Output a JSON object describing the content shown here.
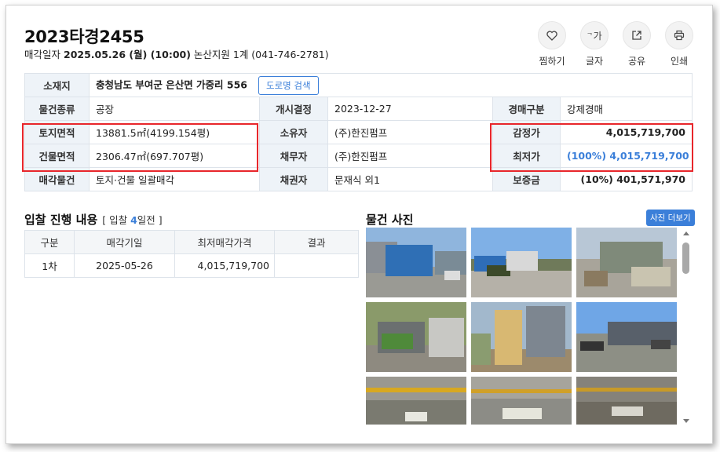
{
  "header": {
    "case_no": "2023타경2455",
    "sale_date_label": "매각일자",
    "sale_date": "2025.05.26 (월) (10:00)",
    "court": "논산지원 1계 (041-746-2781)"
  },
  "actions": [
    {
      "label": "찜하기",
      "icon": "heart-icon"
    },
    {
      "label": "글자",
      "icon": "font-size-icon",
      "glyph": "가"
    },
    {
      "label": "공유",
      "icon": "share-icon"
    },
    {
      "label": "인쇄",
      "icon": "print-icon"
    }
  ],
  "info": {
    "location_label": "소재지",
    "location": "충청남도 부여군 은산면 가중리 556",
    "road_search": "도로명 검색",
    "rows": [
      {
        "l1": "물건종류",
        "v1": "공장",
        "l2": "개시결정",
        "v2": "2023-12-27",
        "l3": "경매구분",
        "v3": "강제경매"
      },
      {
        "l1": "토지면적",
        "v1": "13881.5㎡(4199.154평)",
        "l2": "소유자",
        "v2": "(주)한진펌프",
        "l3": "감정가",
        "v3": "4,015,719,700"
      },
      {
        "l1": "건물면적",
        "v1": "2306.47㎡(697.707평)",
        "l2": "채무자",
        "v2": "(주)한진펌프",
        "l3": "최저가",
        "v3": "(100%) 4,015,719,700"
      },
      {
        "l1": "매각물건",
        "v1": "토지·건물 일괄매각",
        "l2": "채권자",
        "v2": "문재식 외1",
        "l3": "보증금",
        "v3": "(10%) 401,571,970"
      }
    ]
  },
  "bid": {
    "title": "입찰 진행 내용",
    "sub_prefix": "[ 입찰 ",
    "days": "4",
    "sub_suffix": "일전 ]",
    "headers": [
      "구분",
      "매각기일",
      "최저매각가격",
      "결과"
    ],
    "rows": [
      {
        "round": "1차",
        "date": "2025-05-26",
        "price": "4,015,719,700",
        "result": ""
      }
    ]
  },
  "photos": {
    "title": "물건 사진",
    "more": "사진 더보기"
  },
  "colors": {
    "accent": "#3b7fd9",
    "highlight": "#e8262b",
    "header_bg": "#eef3f8"
  }
}
